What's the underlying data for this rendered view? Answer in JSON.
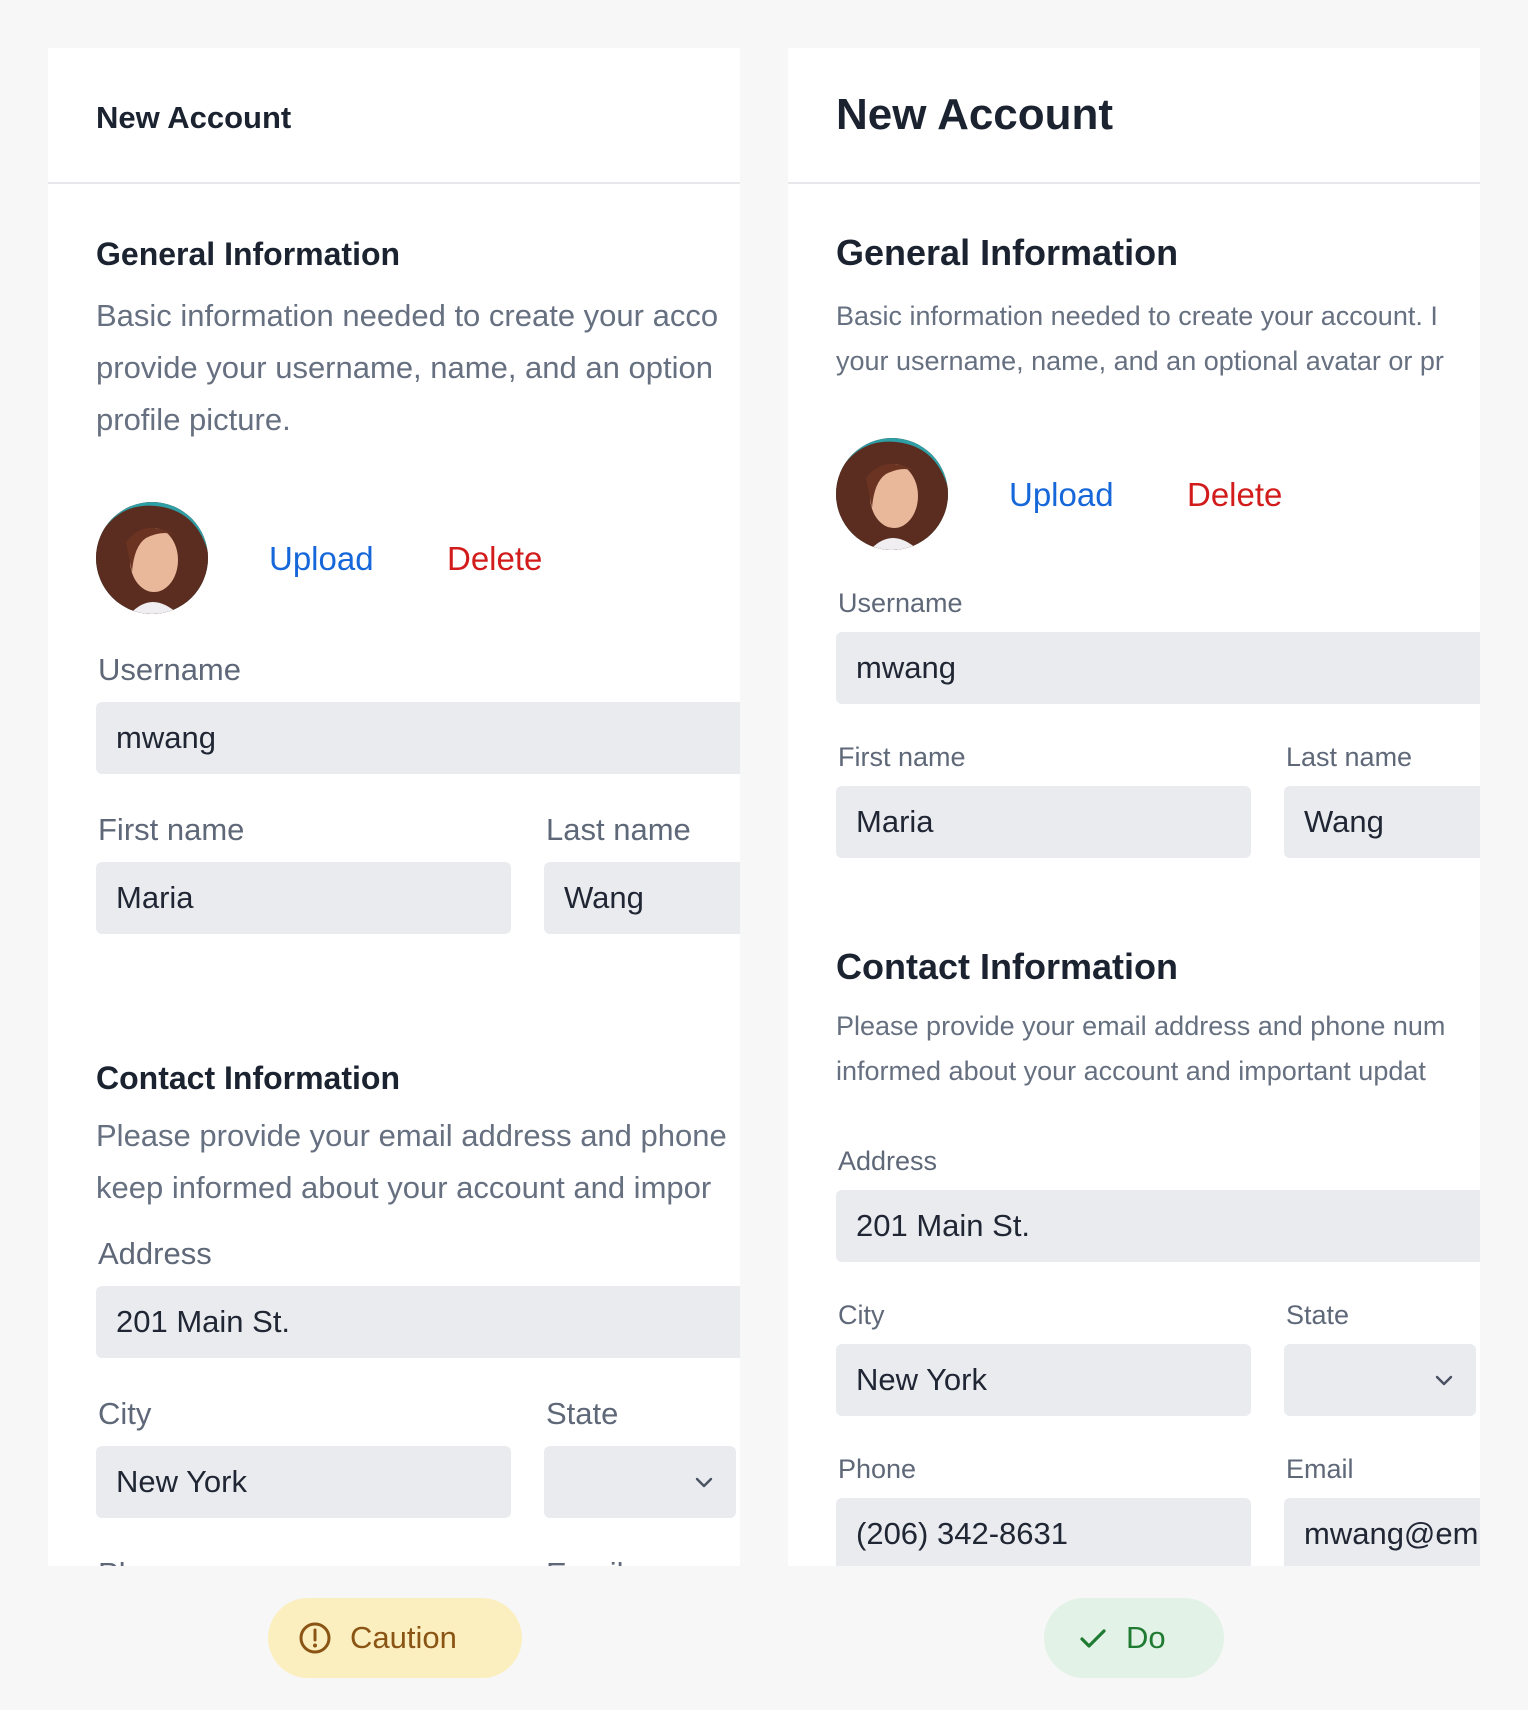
{
  "left": {
    "title": "New Account",
    "general": {
      "title": "General Information",
      "desc_lines": [
        "Basic information needed to create your acco",
        "provide your username, name, and an option",
        "profile picture."
      ]
    },
    "upload_label": "Upload",
    "delete_label": "Delete",
    "username": {
      "label": "Username",
      "value": "mwang"
    },
    "first_name": {
      "label": "First name",
      "value": "Maria"
    },
    "last_name": {
      "label": "Last name",
      "value": "Wang"
    },
    "contact": {
      "title": "Contact Information",
      "desc_lines": [
        "Please provide your email address and phone",
        "keep informed about your account and impor"
      ]
    },
    "address": {
      "label": "Address",
      "value": "201 Main St."
    },
    "city": {
      "label": "City",
      "value": "New York"
    },
    "state": {
      "label": "State",
      "value": ""
    },
    "phone": {
      "label": "Phone"
    },
    "email": {
      "label": "Email"
    }
  },
  "right": {
    "title": "New Account",
    "general": {
      "title": "General Information",
      "desc_lines": [
        "Basic information needed to create your account. I",
        "your username, name, and an optional avatar or pr"
      ]
    },
    "upload_label": "Upload",
    "delete_label": "Delete",
    "username": {
      "label": "Username",
      "value": "mwang"
    },
    "first_name": {
      "label": "First name",
      "value": "Maria"
    },
    "last_name": {
      "label": "Last name",
      "value": "Wang"
    },
    "contact": {
      "title": "Contact Information",
      "desc_lines": [
        "Please provide your email address and phone num",
        "informed about your account and important updat"
      ]
    },
    "address": {
      "label": "Address",
      "value": "201 Main St."
    },
    "city": {
      "label": "City",
      "value": "New York"
    },
    "state": {
      "label": "State",
      "value": ""
    },
    "phone": {
      "label": "Phone",
      "value": "(206) 342-8631"
    },
    "email": {
      "label": "Email",
      "value": "mwang@em"
    }
  },
  "badges": {
    "caution": {
      "label": "Caution",
      "icon": "exclamation-circle-icon",
      "color": "#8a5414",
      "bg": "#fcefbf"
    },
    "do": {
      "label": "Do",
      "icon": "check-icon",
      "color": "#1f7a32",
      "bg": "#e3f2e6"
    }
  },
  "colors": {
    "upload": "#1667d9",
    "delete": "#d21c1c",
    "field_bg": "#e9ebef"
  }
}
